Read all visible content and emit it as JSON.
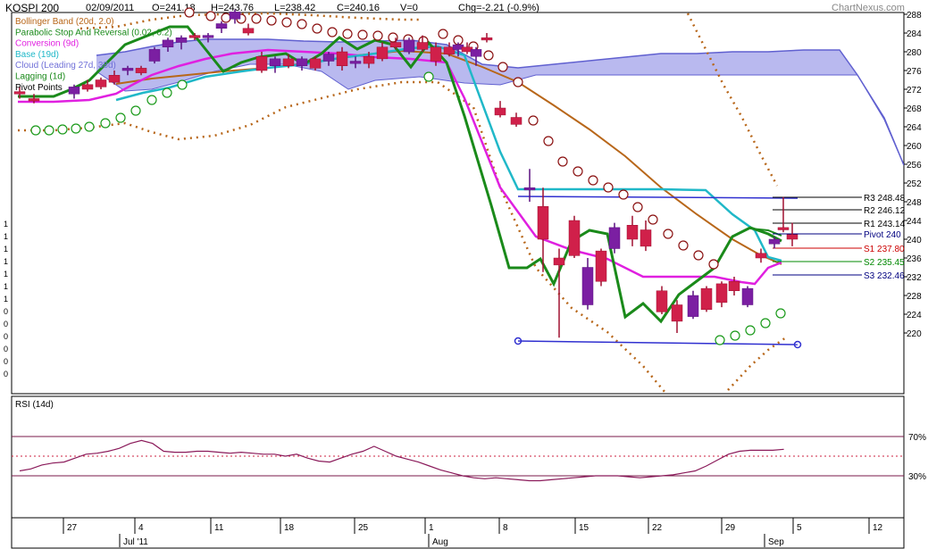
{
  "header": {
    "symbol": "KOSPI 200",
    "date": "02/09/2011",
    "open": "O=241.18",
    "high": "H=243.76",
    "low": "L=238.42",
    "close": "C=240.16",
    "volume": "V=0",
    "change": "Chg=-2.21 (-0.9%)",
    "brand": "ChartNexus.com"
  },
  "legend": [
    {
      "label": "Bollinger Band (20d, 2.0)",
      "color": "#b8671a"
    },
    {
      "label": "Parabolic Stop And Reversal (0.02, 0.2)",
      "color": "#1a8a1a"
    },
    {
      "label": "Conversion (9d)",
      "color": "#e020e0"
    },
    {
      "label": "Base (19d)",
      "color": "#20b8c8"
    },
    {
      "label": "Cloud (Leading 27d, 38d)",
      "color": "#7070d8"
    },
    {
      "label": "Lagging (1d)",
      "color": "#1a8a1a"
    },
    {
      "label": "Pivot Points",
      "color": "#000000"
    }
  ],
  "pivots": [
    {
      "label": "R3 248.48",
      "color": "#000000"
    },
    {
      "label": "R2 246.12",
      "color": "#000000"
    },
    {
      "label": "R1 243.14",
      "color": "#000000"
    },
    {
      "label": "Pivot 240",
      "color": "#000080"
    },
    {
      "label": "S1 237.80",
      "color": "#cc0000"
    },
    {
      "label": "S2 235.45",
      "color": "#008800"
    },
    {
      "label": "S3 232.46",
      "color": "#000080"
    }
  ],
  "left_axis_labels": [
    "1",
    "1",
    "1",
    "1",
    "1",
    "1",
    "1",
    "0",
    "0",
    "0",
    "0",
    "0",
    "0"
  ],
  "rsi": {
    "title": "RSI (14d)",
    "upper_label": "70%",
    "lower_label": "30%"
  },
  "chart_data": {
    "type": "candlestick",
    "price_axis": {
      "ylim": [
        216,
        289
      ],
      "ticks": [
        220,
        224,
        228,
        232,
        236,
        240,
        244,
        248,
        252,
        256,
        260,
        264,
        268,
        272,
        276,
        280,
        284,
        288
      ]
    },
    "x_ticks": [
      "27",
      "4",
      "11",
      "18",
      "25",
      "1",
      "8",
      "15",
      "22",
      "29",
      "5",
      "12"
    ],
    "month_labels": [
      "Jul '11",
      "Aug",
      "Sep"
    ],
    "candles": [
      {
        "o": 271.5,
        "h": 272.5,
        "l": 270.0,
        "c": 271.0,
        "dir": "down"
      },
      {
        "o": 270.0,
        "h": 271.0,
        "l": 269.0,
        "c": 269.5,
        "dir": "down"
      },
      {
        "o": 271.0,
        "h": 273.0,
        "l": 270.0,
        "c": 272.5,
        "dir": "up"
      },
      {
        "o": 273.0,
        "h": 274.0,
        "l": 271.5,
        "c": 272.0,
        "dir": "down"
      },
      {
        "o": 274.0,
        "h": 274.5,
        "l": 272.0,
        "c": 272.5,
        "dir": "down"
      },
      {
        "o": 275.0,
        "h": 276.0,
        "l": 273.0,
        "c": 273.5,
        "dir": "down"
      },
      {
        "o": 276.0,
        "h": 277.0,
        "l": 275.0,
        "c": 276.5,
        "dir": "up"
      },
      {
        "o": 276.5,
        "h": 277.0,
        "l": 275.0,
        "c": 275.5,
        "dir": "down"
      },
      {
        "o": 278.0,
        "h": 281.0,
        "l": 277.5,
        "c": 280.5,
        "dir": "up"
      },
      {
        "o": 281.0,
        "h": 283.0,
        "l": 280.0,
        "c": 282.5,
        "dir": "up"
      },
      {
        "o": 282.0,
        "h": 283.5,
        "l": 280.5,
        "c": 283.0,
        "dir": "up"
      },
      {
        "o": 283.5,
        "h": 284.0,
        "l": 282.5,
        "c": 283.0,
        "dir": "down"
      },
      {
        "o": 283.0,
        "h": 284.0,
        "l": 282.0,
        "c": 283.5,
        "dir": "up"
      },
      {
        "o": 285.0,
        "h": 286.5,
        "l": 284.0,
        "c": 286.0,
        "dir": "up"
      },
      {
        "o": 287.0,
        "h": 289.0,
        "l": 286.0,
        "c": 288.5,
        "dir": "up"
      },
      {
        "o": 285.0,
        "h": 286.0,
        "l": 283.5,
        "c": 284.0,
        "dir": "down"
      },
      {
        "o": 279.0,
        "h": 280.0,
        "l": 275.5,
        "c": 276.0,
        "dir": "down"
      },
      {
        "o": 277.0,
        "h": 279.0,
        "l": 275.5,
        "c": 278.5,
        "dir": "up"
      },
      {
        "o": 278.5,
        "h": 279.5,
        "l": 276.5,
        "c": 277.0,
        "dir": "down"
      },
      {
        "o": 277.0,
        "h": 279.0,
        "l": 276.0,
        "c": 278.5,
        "dir": "up"
      },
      {
        "o": 278.5,
        "h": 279.0,
        "l": 276.0,
        "c": 276.5,
        "dir": "down"
      },
      {
        "o": 278.0,
        "h": 280.0,
        "l": 277.0,
        "c": 279.5,
        "dir": "up"
      },
      {
        "o": 280.0,
        "h": 281.0,
        "l": 276.0,
        "c": 277.0,
        "dir": "down"
      },
      {
        "o": 277.5,
        "h": 279.0,
        "l": 276.5,
        "c": 278.0,
        "dir": "up"
      },
      {
        "o": 279.0,
        "h": 280.0,
        "l": 276.5,
        "c": 277.5,
        "dir": "down"
      },
      {
        "o": 281.0,
        "h": 282.0,
        "l": 278.0,
        "c": 278.5,
        "dir": "down"
      },
      {
        "o": 282.0,
        "h": 283.0,
        "l": 280.5,
        "c": 281.0,
        "dir": "down"
      },
      {
        "o": 280.0,
        "h": 283.0,
        "l": 279.5,
        "c": 282.5,
        "dir": "up"
      },
      {
        "o": 282.0,
        "h": 283.5,
        "l": 280.0,
        "c": 280.5,
        "dir": "down"
      },
      {
        "o": 281.0,
        "h": 282.0,
        "l": 277.0,
        "c": 278.0,
        "dir": "down"
      },
      {
        "o": 281.0,
        "h": 282.0,
        "l": 279.0,
        "c": 279.5,
        "dir": "down"
      },
      {
        "o": 280.5,
        "h": 282.0,
        "l": 279.0,
        "c": 281.5,
        "dir": "up"
      },
      {
        "o": 281.0,
        "h": 282.0,
        "l": 279.5,
        "c": 280.0,
        "dir": "down"
      },
      {
        "o": 279.0,
        "h": 281.0,
        "l": 277.0,
        "c": 280.5,
        "dir": "up"
      },
      {
        "o": 283.0,
        "h": 284.0,
        "l": 282.0,
        "c": 282.5,
        "dir": "down"
      },
      {
        "o": 268.0,
        "h": 269.5,
        "l": 266.0,
        "c": 266.5,
        "dir": "down"
      },
      {
        "o": 266.0,
        "h": 267.0,
        "l": 264.0,
        "c": 264.5,
        "dir": "down"
      },
      {
        "o": 251.0,
        "h": 255.0,
        "l": 248.0,
        "c": 250.5,
        "dir": "up"
      },
      {
        "o": 247.0,
        "h": 251.0,
        "l": 233.0,
        "c": 240.0,
        "dir": "down"
      },
      {
        "o": 236.0,
        "h": 238.0,
        "l": 219.0,
        "c": 234.5,
        "dir": "down"
      },
      {
        "o": 244.0,
        "h": 245.0,
        "l": 236.0,
        "c": 236.5,
        "dir": "down"
      },
      {
        "o": 234.0,
        "h": 236.0,
        "l": 225.0,
        "c": 226.0,
        "dir": "up"
      },
      {
        "o": 231.0,
        "h": 238.0,
        "l": 230.0,
        "c": 237.5,
        "dir": "down"
      },
      {
        "o": 238.0,
        "h": 243.5,
        "l": 237.0,
        "c": 242.5,
        "dir": "up"
      },
      {
        "o": 240.0,
        "h": 245.0,
        "l": 238.5,
        "c": 243.0,
        "dir": "down"
      },
      {
        "o": 242.0,
        "h": 244.0,
        "l": 237.5,
        "c": 238.5,
        "dir": "down"
      },
      {
        "o": 229.0,
        "h": 230.0,
        "l": 224.0,
        "c": 224.5,
        "dir": "down"
      },
      {
        "o": 226.0,
        "h": 227.0,
        "l": 220.0,
        "c": 222.5,
        "dir": "down"
      },
      {
        "o": 223.5,
        "h": 229.0,
        "l": 223.0,
        "c": 228.0,
        "dir": "up"
      },
      {
        "o": 225.0,
        "h": 230.0,
        "l": 224.5,
        "c": 229.5,
        "dir": "down"
      },
      {
        "o": 226.5,
        "h": 231.0,
        "l": 225.5,
        "c": 230.5,
        "dir": "down"
      },
      {
        "o": 229.0,
        "h": 232.0,
        "l": 228.0,
        "c": 231.0,
        "dir": "down"
      },
      {
        "o": 226.0,
        "h": 230.0,
        "l": 225.5,
        "c": 229.5,
        "dir": "up"
      },
      {
        "o": 237.0,
        "h": 238.0,
        "l": 235.0,
        "c": 236.0,
        "dir": "down"
      },
      {
        "o": 239.0,
        "h": 240.5,
        "l": 238.0,
        "c": 240.0,
        "dir": "up"
      },
      {
        "o": 242.0,
        "h": 249.0,
        "l": 241.5,
        "c": 242.5,
        "dir": "down"
      },
      {
        "o": 241.0,
        "h": 243.5,
        "l": 238.5,
        "c": 240.0,
        "dir": "down"
      }
    ],
    "rsi_values": [
      35,
      37,
      41,
      43,
      44,
      48,
      52,
      53,
      55,
      58,
      63,
      66,
      63,
      55,
      54,
      54,
      55,
      55,
      54,
      53,
      54,
      53,
      52,
      52,
      50,
      52,
      48,
      45,
      44,
      48,
      52,
      55,
      60,
      55,
      50,
      47,
      44,
      40,
      36,
      33,
      30,
      28,
      27,
      28,
      27,
      26,
      25,
      25,
      26,
      27,
      28,
      29,
      30,
      30,
      30,
      29,
      28,
      29,
      30,
      31,
      33,
      35,
      40,
      46,
      52,
      55,
      56,
      56,
      56,
      57
    ]
  }
}
